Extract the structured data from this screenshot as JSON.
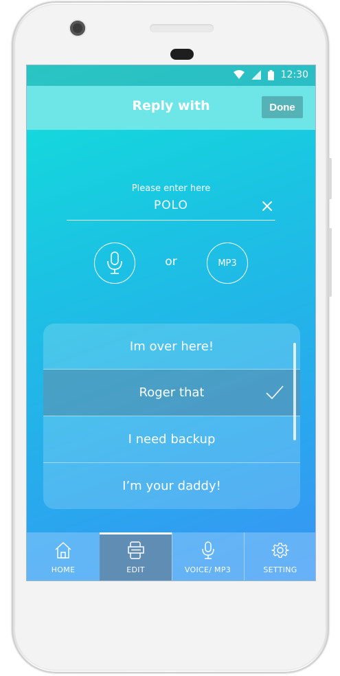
{
  "status_bar": {
    "time": "12:30"
  },
  "header": {
    "title": "Reply with",
    "done_label": "Done"
  },
  "input": {
    "label": "Please enter here",
    "value": "POLO"
  },
  "options": {
    "or_text": "or",
    "mp3_label": "MP3"
  },
  "replies": [
    {
      "text": "Im over here!",
      "selected": false
    },
    {
      "text": "Roger that",
      "selected": true
    },
    {
      "text": "I need backup",
      "selected": false
    },
    {
      "text": "I’m your daddy!",
      "selected": false
    }
  ],
  "tabs": [
    {
      "label": "HOME",
      "icon": "home-icon",
      "active": false
    },
    {
      "label": "EDIT",
      "icon": "edit-icon",
      "active": true
    },
    {
      "label": "VOICE/ MP3",
      "icon": "mic-icon",
      "active": false
    },
    {
      "label": "SETTING",
      "icon": "gear-icon",
      "active": false
    }
  ],
  "colors": {
    "accent": "#6ee6e8",
    "done_button": "#55b3b8",
    "active_tab": "#5f8db3",
    "gradient_top": "#12e0da",
    "gradient_bottom": "#3a93f5"
  }
}
